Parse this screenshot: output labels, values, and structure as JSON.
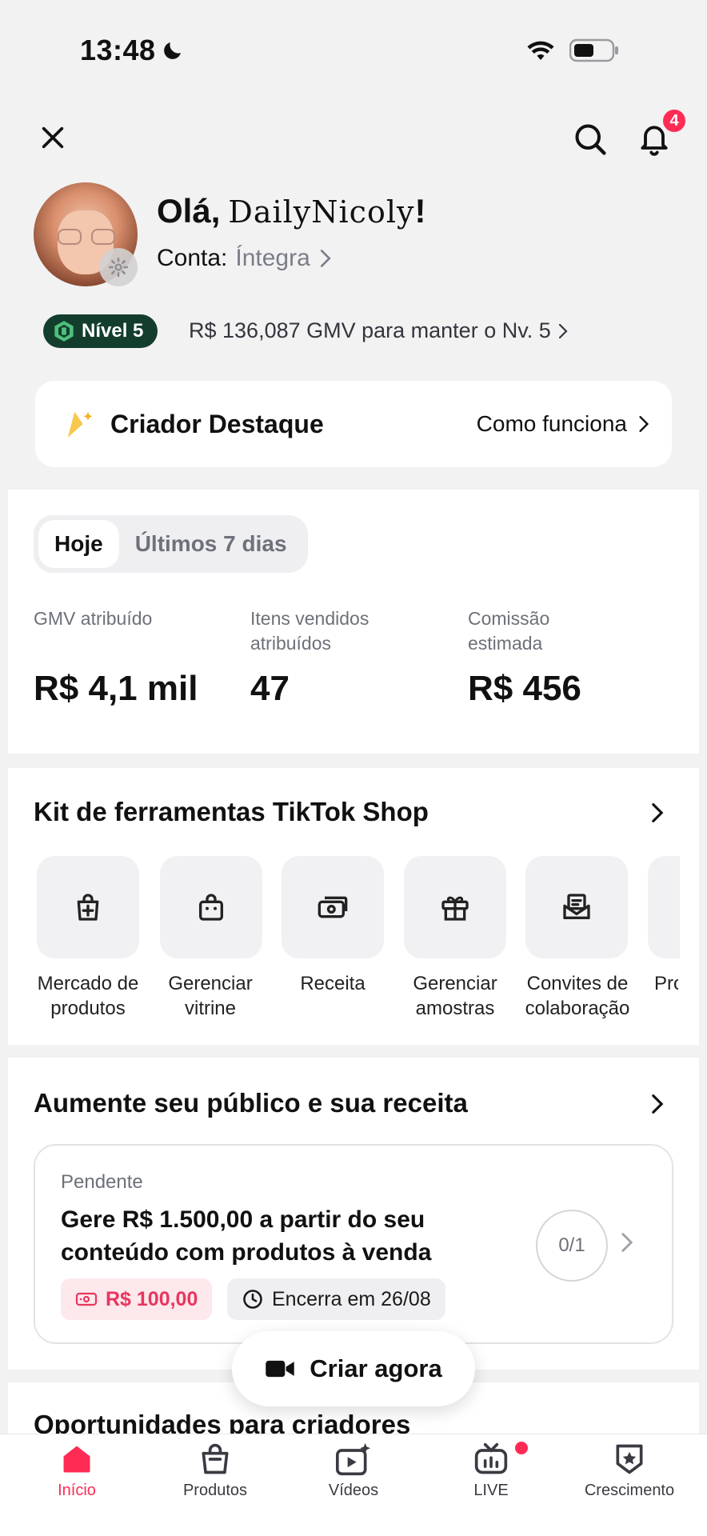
{
  "status_bar": {
    "time": "13:48"
  },
  "header": {
    "notification_count": "4"
  },
  "profile": {
    "greeting": "Olá,",
    "name": "DailyNicoly",
    "exclaim": "!",
    "account_label": "Conta:",
    "account_value": "Íntegra"
  },
  "level": {
    "badge": "Nível 5",
    "text": "R$ 136,087 GMV para manter o Nv. 5"
  },
  "creator": {
    "title": "Criador Destaque",
    "link": "Como funciona"
  },
  "stats": {
    "tabs": [
      "Hoje",
      "Últimos 7 dias"
    ],
    "active_tab": "Hoje",
    "items": [
      {
        "label": "GMV atribuído",
        "value": "R$ 4,1 mil"
      },
      {
        "label": "Itens vendidos atribuídos",
        "value": "47"
      },
      {
        "label": "Comissão estimada",
        "value": "R$ 456"
      }
    ]
  },
  "toolkit": {
    "title": "Kit de ferramentas TikTok Shop",
    "tools": [
      {
        "label": "Mercado de produtos",
        "icon": "shopping-bag-plus-icon"
      },
      {
        "label": "Gerenciar vitrine",
        "icon": "store-bag-icon"
      },
      {
        "label": "Receita",
        "icon": "money-icon"
      },
      {
        "label": "Gerenciar amostras",
        "icon": "gift-icon"
      },
      {
        "label": "Convites de colaboração",
        "icon": "envelope-icon"
      },
      {
        "label": "Pro",
        "icon": "partial-icon"
      }
    ]
  },
  "growth": {
    "title": "Aumente seu público e sua receita",
    "task": {
      "status": "Pendente",
      "title": "Gere R$ 1.500,00 a partir do seu conteúdo com produtos à venda",
      "progress": "0/1",
      "reward": "R$ 100,00",
      "deadline": "Encerra em 26/08"
    },
    "cta": "Criar agora"
  },
  "next_section": {
    "title": "Oportunidades para criadores"
  },
  "bottom_nav": [
    {
      "label": "Início",
      "active": true
    },
    {
      "label": "Produtos",
      "active": false
    },
    {
      "label": "Vídeos",
      "active": false
    },
    {
      "label": "LIVE",
      "active": false
    },
    {
      "label": "Crescimento",
      "active": false
    }
  ],
  "colors": {
    "accent": "#fe2c55",
    "level_green": "#133e2e",
    "background": "#f2f2f3"
  }
}
